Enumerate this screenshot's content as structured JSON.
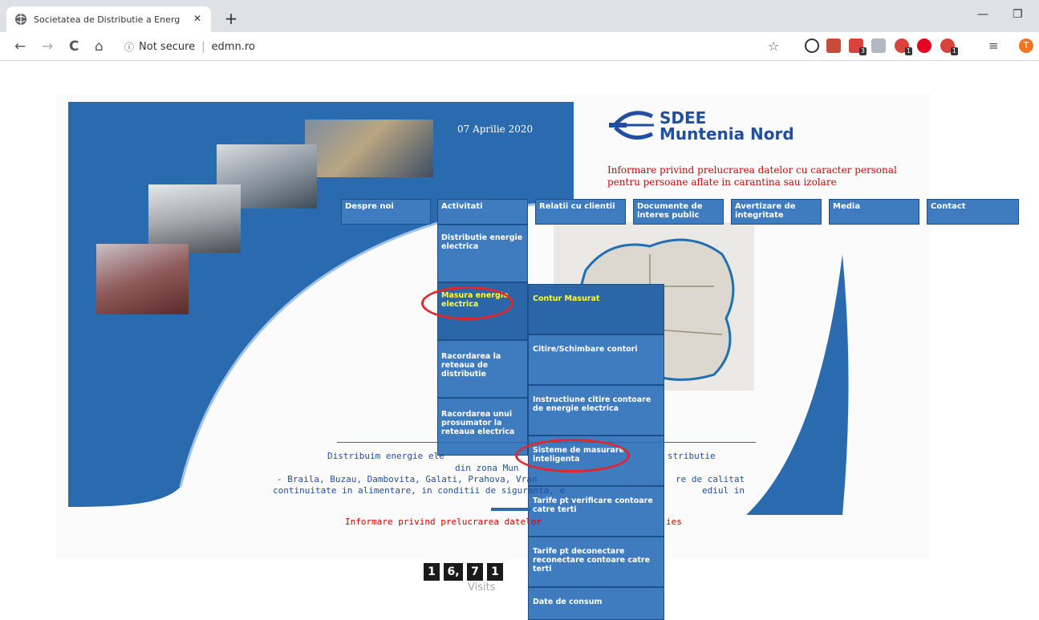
{
  "browser": {
    "tab_title": "Societatea de Distributie a Energ",
    "close_glyph": "✕",
    "new_tab_glyph": "+",
    "security_label": "Not secure",
    "url": "edmn.ro",
    "extension_badges": [
      "3",
      "1",
      "1"
    ],
    "profile_initial": "T",
    "minimize_glyph": "—",
    "restore_glyph": "❐",
    "back_glyph": "←",
    "forward_glyph": "→",
    "reload_glyph": "C",
    "home_glyph": "⌂",
    "info_glyph": "ⓘ",
    "star_glyph": "☆",
    "menu_glyph": "≡"
  },
  "header": {
    "date": "07 Aprilie 2020",
    "logo_line1": "SDEE",
    "logo_line2": "Muntenia Nord",
    "notice": "Informare privind prelucrarea datelor cu caracter personal pentru persoane aflate in carantina sau izolare"
  },
  "menu": {
    "items": [
      "Despre noi",
      "Activitati",
      "Relatii cu clientii",
      "Documente de interes public",
      "Avertizare de integritate",
      "Media",
      "Contact"
    ]
  },
  "submenu_activitati": [
    "Distributie energie electrica",
    "Masura energie electrica",
    "Racordarea la reteaua de distributie",
    "Racordarea unui prosumator la reteaua electrica"
  ],
  "submenu_masura": [
    "Contur Masurat",
    "Citire/Schimbare contori",
    "Instructiune citire contoare de energie electrica",
    "Sisteme de masurare inteligenta",
    "Tarife pt verificare contoare catre terti",
    "Tarife pt deconectare reconectare contoare catre terti",
    "Date de consum"
  ],
  "body": {
    "line1_left": "Distribuim energie ele",
    "line1_right": "stributie",
    "line2": "din zona Mun",
    "line3_left": "- Braila, Buzau, Dambovita, Galati, Prahova, Vran",
    "line3_right": "re de calitat",
    "line4": "continuitate in alimentare, in conditii de siguranta, e",
    "line4_right": "ediul in",
    "footer_notice": "Informare privind prelucrarea datelor",
    "footer_notice_right": "ies"
  },
  "counter": {
    "digits": [
      "1",
      "6,",
      "7",
      "1"
    ],
    "label": "Visits"
  },
  "colors": {
    "brand_blue": "#2a6bb0",
    "menu_blue": "#3f7bbf",
    "highlight_yellow": "#ffff33",
    "annotation_red": "#e3262b",
    "notice_red": "#d40000"
  }
}
